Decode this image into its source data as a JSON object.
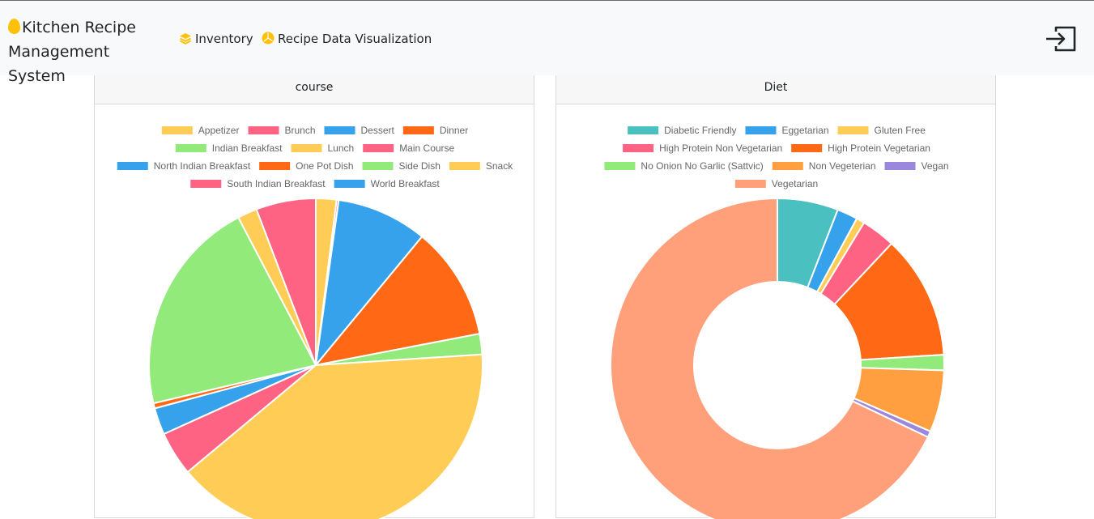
{
  "app": {
    "title": "Kitchen Recipe Management System",
    "title_line1": "Kitchen Recipe",
    "title_line2": "Management System",
    "brand_icon": "egg-icon"
  },
  "nav": {
    "items": [
      {
        "label": "Inventory",
        "icon": "layers-icon"
      },
      {
        "label": "Recipe Data Visualization",
        "icon": "pie-chart-icon"
      }
    ],
    "logout_icon": "logout-icon"
  },
  "colors": {
    "accent": "#ffc107",
    "navbar_bg": "#f8f9fa"
  },
  "chart_data": [
    {
      "type": "pie",
      "title": "course",
      "legend_position": "top",
      "categories": [
        "Appetizer",
        "Brunch",
        "Dessert",
        "Dinner",
        "Indian Breakfast",
        "Lunch",
        "Main Course",
        "North Indian Breakfast",
        "One Pot Dish",
        "Side Dish",
        "Snack",
        "South Indian Breakfast",
        "World Breakfast"
      ],
      "values": [
        2,
        0.2,
        8.8,
        11,
        2,
        40,
        4.3,
        2.6,
        0.5,
        21,
        1.9,
        5.8,
        0
      ],
      "colors": [
        "#ffcd56",
        "#ff6384",
        "#36a2eb",
        "#ff6916",
        "#91ea7a",
        "#ffcd56",
        "#ff6384",
        "#36a2eb",
        "#ff6916",
        "#91ea7a",
        "#ffcd56",
        "#ff6384",
        "#36a2eb"
      ]
    },
    {
      "type": "doughnut",
      "title": "Diet",
      "legend_position": "top",
      "categories": [
        "Diabetic Friendly",
        "Eggetarian",
        "Gluten Free",
        "High Protein Non Vegetarian",
        "High Protein Vegetarian",
        "No Onion No Garlic (Sattvic)",
        "Non Vegeterian",
        "Vegan",
        "Vegetarian"
      ],
      "values": [
        5.9,
        2.0,
        0.8,
        3.3,
        12.0,
        1.5,
        6.0,
        0.6,
        67.9
      ],
      "colors": [
        "#4bc0c0",
        "#36a2eb",
        "#ffcd56",
        "#ff6384",
        "#ff6916",
        "#91ea7a",
        "#ff9f40",
        "#9b88dc",
        "#ffa07a"
      ]
    }
  ]
}
